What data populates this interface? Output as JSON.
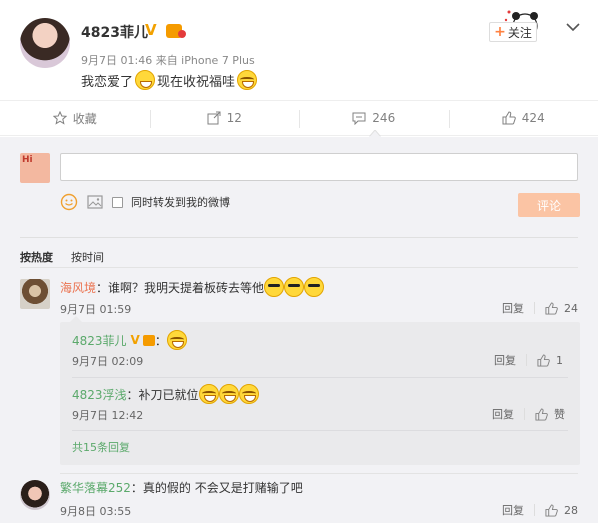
{
  "post": {
    "name": "4823菲儿",
    "meta": "9月7日 01:46 来自 iPhone 7 Plus",
    "text_before": "我恋爱了",
    "text_after": "现在收祝福哇",
    "follow_label": "关注"
  },
  "actions": [
    {
      "icon": "star-icon",
      "label": "收藏"
    },
    {
      "icon": "share-icon",
      "label": "12"
    },
    {
      "icon": "comment-icon",
      "label": "246"
    },
    {
      "icon": "like-icon",
      "label": "424"
    }
  ],
  "compose": {
    "forward_label": "同时转发到我的微博",
    "submit_label": "评论"
  },
  "sort": {
    "hot": "按热度",
    "time": "按时间"
  },
  "comments": [
    {
      "user": "海风境",
      "text": "：谁啊？我明天提着板砖去等他",
      "date": "9月7日 01:59",
      "reply": "回复",
      "likes": "24"
    },
    {
      "user": "繁华落幕252",
      "text": "：真的假的 不会又是打赌输了吧",
      "date": "9月8日 03:55",
      "reply": "回复",
      "likes": "28"
    }
  ],
  "replies": [
    {
      "user": "4823菲儿",
      "text": "：",
      "date": "9月7日 02:09",
      "reply": "回复",
      "likes": "1"
    },
    {
      "user": "4823浮浅",
      "text": "：补刀已就位",
      "date": "9月7日 12:42",
      "reply": "回复",
      "likes": "赞"
    }
  ],
  "more_replies": "共15条回复",
  "colors": {
    "link_orange": "#eb7350",
    "link_green": "#5ba96b",
    "submit_disabled": "#fbc4a4"
  }
}
